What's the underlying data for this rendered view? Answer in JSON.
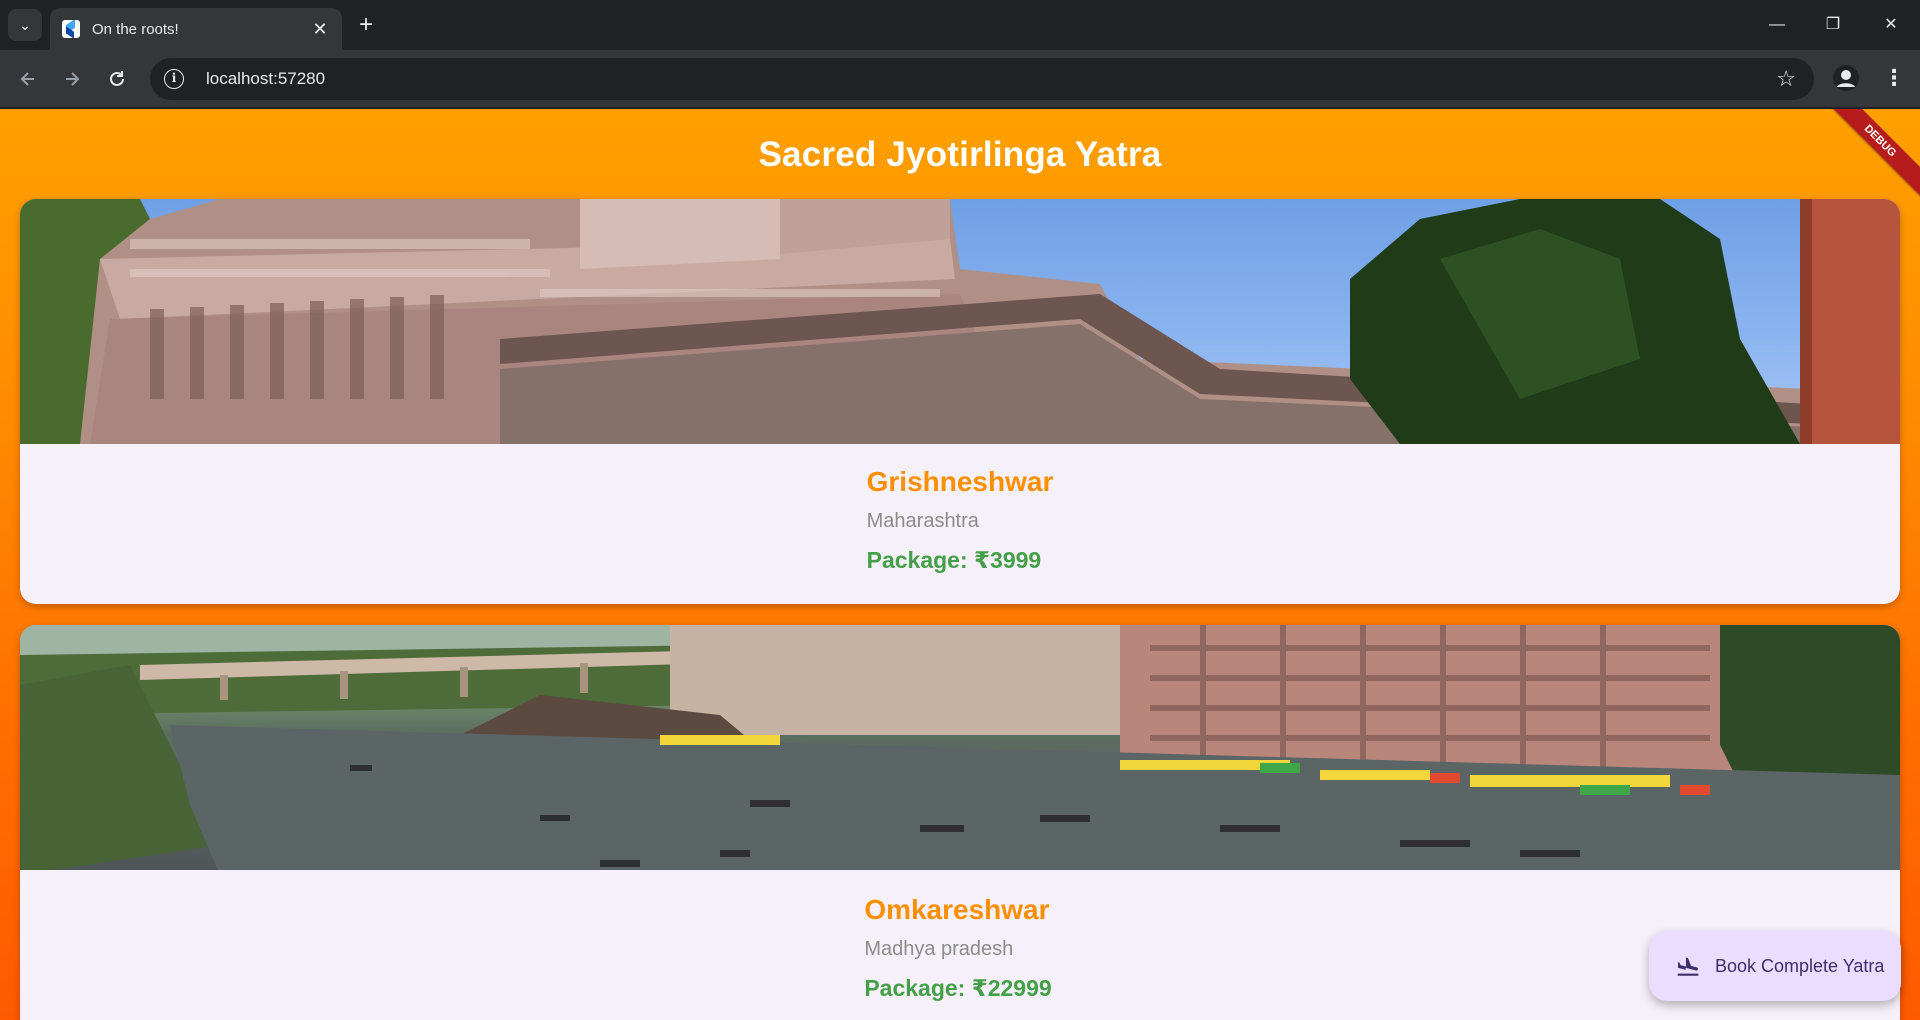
{
  "browser": {
    "tab_title": "On the roots!",
    "tab_close": "✕",
    "new_tab": "+",
    "url": "localhost:57280",
    "window_controls": {
      "minimize": "—",
      "restore": "❐",
      "close": "✕"
    },
    "icons": [
      "tab-search-icon",
      "flutter-favicon",
      "back-icon",
      "forward-icon",
      "reload-icon",
      "site-info-icon",
      "bookmark-star-icon",
      "profile-icon",
      "kebab-menu-icon"
    ]
  },
  "app": {
    "title": "Sacred Jyotirlinga Yatra",
    "debug_banner": "DEBUG",
    "colors": {
      "header_orange": "#ffa000",
      "gradient_bottom": "#ff5a00",
      "name_orange": "#ff8f00",
      "price_green": "#43a047",
      "card_bg": "#f6f0fa",
      "fab_bg": "#eaddff"
    },
    "cards": [
      {
        "name": "Grishneshwar",
        "state": "Maharashtra",
        "price": "Package: ₹3999",
        "image": "temple-carved-stone-photo"
      },
      {
        "name": "Omkareshwar",
        "state": "Madhya pradesh",
        "price": "Package: ₹22999",
        "image": "river-ghat-boats-photo"
      }
    ],
    "fab": {
      "label": "Book Complete Yatra",
      "icon": "flight-land-icon"
    }
  }
}
